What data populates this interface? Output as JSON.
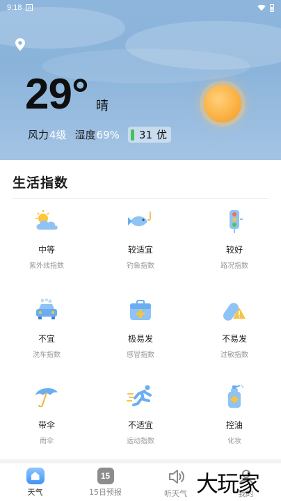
{
  "status_bar": {
    "time": "9:18",
    "notification_glyph": "A"
  },
  "header": {
    "temperature": "29°",
    "condition": "晴",
    "wind_label": "风力",
    "wind_value": "4级",
    "humidity_label": "湿度",
    "humidity_value": "69%",
    "aqi_value": "31",
    "aqi_text": "优",
    "colors": {
      "sky_top": "#8eb6dd",
      "sun": "#fbb244",
      "aqi_good": "#42c25a"
    }
  },
  "life_index": {
    "title": "生活指数",
    "items": [
      {
        "value": "中等",
        "name": "紫外线指数",
        "icon": "sun-cloud-icon"
      },
      {
        "value": "较适宜",
        "name": "钓鱼指数",
        "icon": "fish-icon"
      },
      {
        "value": "较好",
        "name": "路况指数",
        "icon": "traffic-light-icon"
      },
      {
        "value": "不宜",
        "name": "洗车指数",
        "icon": "car-wash-icon"
      },
      {
        "value": "极易发",
        "name": "感冒指数",
        "icon": "medkit-icon"
      },
      {
        "value": "不易发",
        "name": "过敏指数",
        "icon": "pill-warning-icon"
      },
      {
        "value": "带伞",
        "name": "雨伞",
        "icon": "umbrella-icon"
      },
      {
        "value": "不适宜",
        "name": "运动指数",
        "icon": "runner-icon"
      },
      {
        "value": "控油",
        "name": "化妆",
        "icon": "lotion-icon"
      }
    ]
  },
  "nav": {
    "items": [
      {
        "label": "天气",
        "active": true
      },
      {
        "label": "15日预报",
        "badge": "15"
      },
      {
        "label": "听天气"
      },
      {
        "label": "我的"
      }
    ]
  },
  "watermark": "大玩家"
}
